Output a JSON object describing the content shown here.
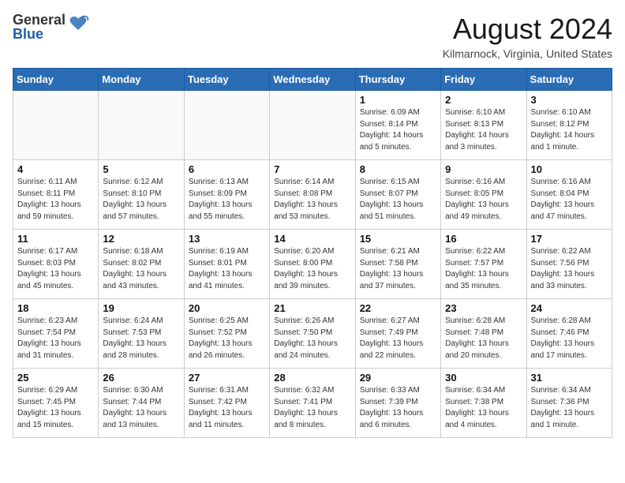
{
  "header": {
    "logo_general": "General",
    "logo_blue": "Blue",
    "month_year": "August 2024",
    "location": "Kilmarnock, Virginia, United States"
  },
  "days_of_week": [
    "Sunday",
    "Monday",
    "Tuesday",
    "Wednesday",
    "Thursday",
    "Friday",
    "Saturday"
  ],
  "weeks": [
    [
      {
        "day": "",
        "info": ""
      },
      {
        "day": "",
        "info": ""
      },
      {
        "day": "",
        "info": ""
      },
      {
        "day": "",
        "info": ""
      },
      {
        "day": "1",
        "info": "Sunrise: 6:09 AM\nSunset: 8:14 PM\nDaylight: 14 hours\nand 5 minutes."
      },
      {
        "day": "2",
        "info": "Sunrise: 6:10 AM\nSunset: 8:13 PM\nDaylight: 14 hours\nand 3 minutes."
      },
      {
        "day": "3",
        "info": "Sunrise: 6:10 AM\nSunset: 8:12 PM\nDaylight: 14 hours\nand 1 minute."
      }
    ],
    [
      {
        "day": "4",
        "info": "Sunrise: 6:11 AM\nSunset: 8:11 PM\nDaylight: 13 hours\nand 59 minutes."
      },
      {
        "day": "5",
        "info": "Sunrise: 6:12 AM\nSunset: 8:10 PM\nDaylight: 13 hours\nand 57 minutes."
      },
      {
        "day": "6",
        "info": "Sunrise: 6:13 AM\nSunset: 8:09 PM\nDaylight: 13 hours\nand 55 minutes."
      },
      {
        "day": "7",
        "info": "Sunrise: 6:14 AM\nSunset: 8:08 PM\nDaylight: 13 hours\nand 53 minutes."
      },
      {
        "day": "8",
        "info": "Sunrise: 6:15 AM\nSunset: 8:07 PM\nDaylight: 13 hours\nand 51 minutes."
      },
      {
        "day": "9",
        "info": "Sunrise: 6:16 AM\nSunset: 8:05 PM\nDaylight: 13 hours\nand 49 minutes."
      },
      {
        "day": "10",
        "info": "Sunrise: 6:16 AM\nSunset: 8:04 PM\nDaylight: 13 hours\nand 47 minutes."
      }
    ],
    [
      {
        "day": "11",
        "info": "Sunrise: 6:17 AM\nSunset: 8:03 PM\nDaylight: 13 hours\nand 45 minutes."
      },
      {
        "day": "12",
        "info": "Sunrise: 6:18 AM\nSunset: 8:02 PM\nDaylight: 13 hours\nand 43 minutes."
      },
      {
        "day": "13",
        "info": "Sunrise: 6:19 AM\nSunset: 8:01 PM\nDaylight: 13 hours\nand 41 minutes."
      },
      {
        "day": "14",
        "info": "Sunrise: 6:20 AM\nSunset: 8:00 PM\nDaylight: 13 hours\nand 39 minutes."
      },
      {
        "day": "15",
        "info": "Sunrise: 6:21 AM\nSunset: 7:58 PM\nDaylight: 13 hours\nand 37 minutes."
      },
      {
        "day": "16",
        "info": "Sunrise: 6:22 AM\nSunset: 7:57 PM\nDaylight: 13 hours\nand 35 minutes."
      },
      {
        "day": "17",
        "info": "Sunrise: 6:22 AM\nSunset: 7:56 PM\nDaylight: 13 hours\nand 33 minutes."
      }
    ],
    [
      {
        "day": "18",
        "info": "Sunrise: 6:23 AM\nSunset: 7:54 PM\nDaylight: 13 hours\nand 31 minutes."
      },
      {
        "day": "19",
        "info": "Sunrise: 6:24 AM\nSunset: 7:53 PM\nDaylight: 13 hours\nand 28 minutes."
      },
      {
        "day": "20",
        "info": "Sunrise: 6:25 AM\nSunset: 7:52 PM\nDaylight: 13 hours\nand 26 minutes."
      },
      {
        "day": "21",
        "info": "Sunrise: 6:26 AM\nSunset: 7:50 PM\nDaylight: 13 hours\nand 24 minutes."
      },
      {
        "day": "22",
        "info": "Sunrise: 6:27 AM\nSunset: 7:49 PM\nDaylight: 13 hours\nand 22 minutes."
      },
      {
        "day": "23",
        "info": "Sunrise: 6:28 AM\nSunset: 7:48 PM\nDaylight: 13 hours\nand 20 minutes."
      },
      {
        "day": "24",
        "info": "Sunrise: 6:28 AM\nSunset: 7:46 PM\nDaylight: 13 hours\nand 17 minutes."
      }
    ],
    [
      {
        "day": "25",
        "info": "Sunrise: 6:29 AM\nSunset: 7:45 PM\nDaylight: 13 hours\nand 15 minutes."
      },
      {
        "day": "26",
        "info": "Sunrise: 6:30 AM\nSunset: 7:44 PM\nDaylight: 13 hours\nand 13 minutes."
      },
      {
        "day": "27",
        "info": "Sunrise: 6:31 AM\nSunset: 7:42 PM\nDaylight: 13 hours\nand 11 minutes."
      },
      {
        "day": "28",
        "info": "Sunrise: 6:32 AM\nSunset: 7:41 PM\nDaylight: 13 hours\nand 8 minutes."
      },
      {
        "day": "29",
        "info": "Sunrise: 6:33 AM\nSunset: 7:39 PM\nDaylight: 13 hours\nand 6 minutes."
      },
      {
        "day": "30",
        "info": "Sunrise: 6:34 AM\nSunset: 7:38 PM\nDaylight: 13 hours\nand 4 minutes."
      },
      {
        "day": "31",
        "info": "Sunrise: 6:34 AM\nSunset: 7:36 PM\nDaylight: 13 hours\nand 1 minute."
      }
    ]
  ]
}
